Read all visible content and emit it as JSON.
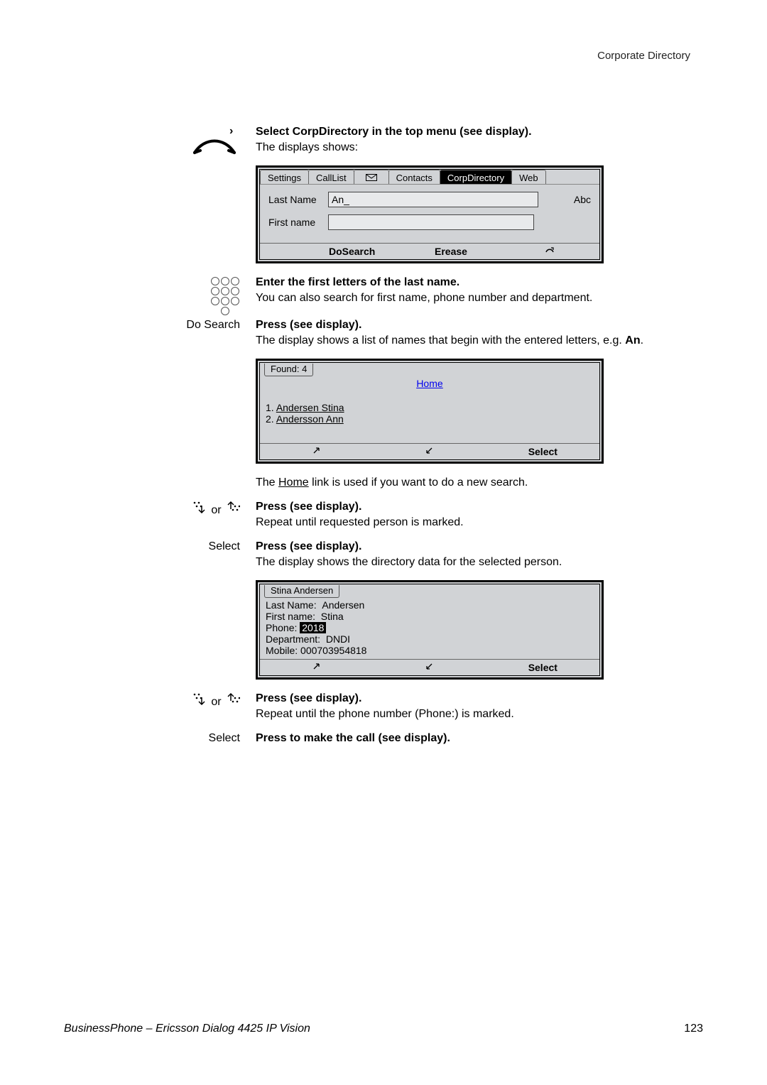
{
  "header": {
    "running_head": "Corporate Directory"
  },
  "steps": {
    "s1_bold": "Select CorpDirectory in the top menu (see display).",
    "s1_desc": "The displays shows:",
    "s2_bold": "Enter the first letters of the last name.",
    "s2_desc": "You can also search for first name, phone number and department.",
    "s3_label": "Do Search",
    "s3_bold": "Press (see display).",
    "s3_desc_a": "The display shows a list of names that begin with the entered letters, e.g. ",
    "s3_desc_b": "An",
    "s3_desc_c": ".",
    "home_note_a": "The ",
    "home_note_b": "Home",
    "home_note_c": " link is used if you want to do a new search.",
    "s4_label_or": " or ",
    "s4_bold": "Press (see display).",
    "s4_desc": "Repeat until requested person is marked.",
    "s5_label": "Select",
    "s5_bold": "Press (see display).",
    "s5_desc": "The display shows the directory data for the selected person.",
    "s6_label_or": " or ",
    "s6_bold": "Press (see display).",
    "s6_desc": "Repeat until the phone number (Phone:) is marked.",
    "s7_label": "Select",
    "s7_bold": "Press to make the call (see display)."
  },
  "screen1": {
    "tabs": [
      "Settings",
      "CallList",
      "",
      "Contacts",
      "CorpDirectory",
      "Web"
    ],
    "selected_tab": "CorpDirectory",
    "last_name_label": "Last Name",
    "first_name_label": "First name",
    "last_name_value": "An_",
    "first_name_value": "",
    "input_mode": "Abc",
    "softkeys": [
      "DoSearch",
      "Erease",
      ""
    ]
  },
  "screen2": {
    "title": "Found: 4",
    "home_link": "Home",
    "results": [
      {
        "idx": "1.",
        "name": "Andersen Stina"
      },
      {
        "idx": "2.",
        "name": "Andersson Ann"
      }
    ],
    "softkeys": [
      "",
      "",
      "Select"
    ]
  },
  "screen3": {
    "title": "Stina Andersen",
    "fields": {
      "last_name_l": "Last Name:",
      "last_name_v": "Andersen",
      "first_name_l": "First name:",
      "first_name_v": "Stina",
      "phone_l": "Phone:",
      "phone_v": "2018",
      "dept_l": "Department:",
      "dept_v": "DNDI",
      "mobile_l": "Mobile:",
      "mobile_v": "000703954818"
    },
    "softkeys": [
      "",
      "",
      "Select"
    ]
  },
  "footer": {
    "title": "BusinessPhone – Ericsson Dialog 4425 IP Vision",
    "page": "123"
  }
}
